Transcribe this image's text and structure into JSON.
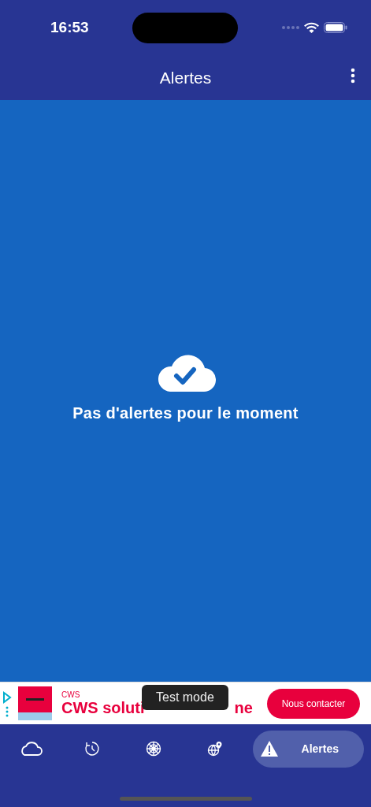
{
  "status_bar": {
    "time": "16:53"
  },
  "header": {
    "title": "Alertes"
  },
  "empty_state": {
    "message": "Pas d'alertes pour le moment"
  },
  "ad": {
    "advertiser": "CWS",
    "headline_start": "CWS soluti",
    "headline_end": "ne",
    "button": "Nous contacter",
    "toast": "Test mode"
  },
  "tabs": [
    {
      "kind": "weather",
      "selected": false
    },
    {
      "kind": "history",
      "selected": false
    },
    {
      "kind": "radar",
      "selected": false
    },
    {
      "kind": "globe",
      "selected": false
    },
    {
      "kind": "alerts",
      "label": "Alertes",
      "selected": true
    }
  ]
}
